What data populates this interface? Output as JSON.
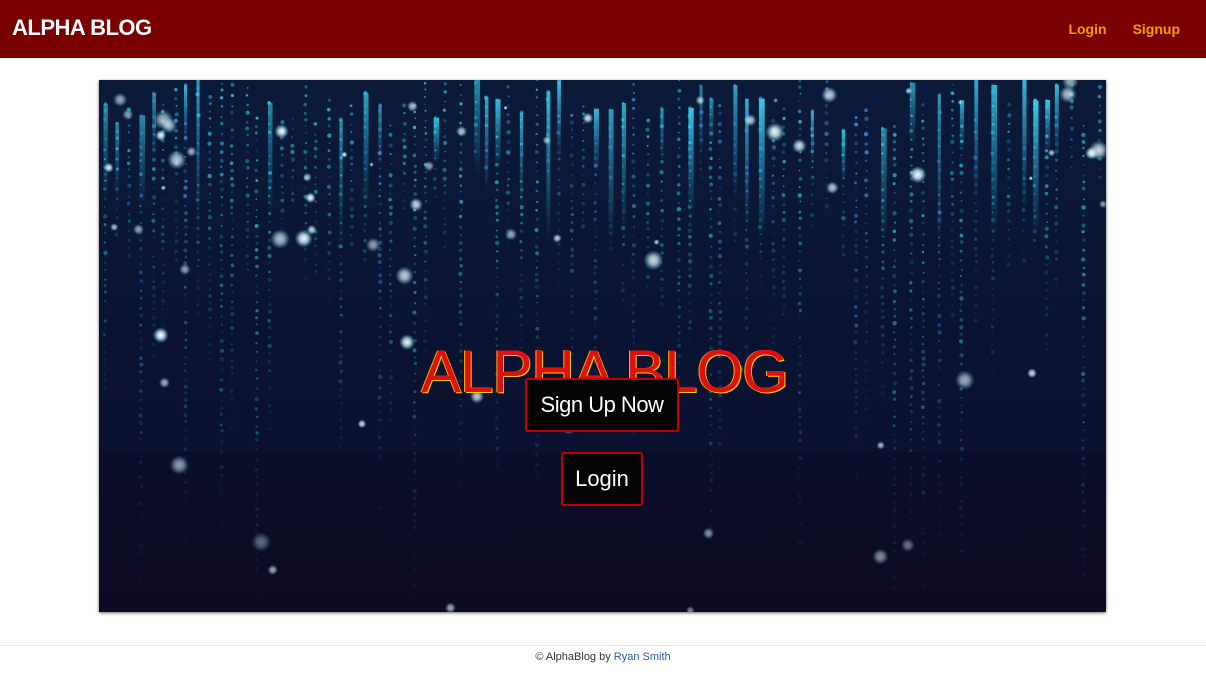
{
  "navbar": {
    "brand": "ALPHA BLOG",
    "links": [
      {
        "label": "Login"
      },
      {
        "label": "Signup"
      }
    ],
    "colors": {
      "background": "#7a0000",
      "link": "#f0a000",
      "brand": "#ffffff"
    }
  },
  "hero": {
    "background_image": "digital-rain-particles",
    "title": "ALPHA BLOG",
    "title_color": "#e01010",
    "buttons": {
      "signup": "Sign Up Now",
      "login": "Login"
    }
  },
  "footer": {
    "prefix": "© AlphaBlog by",
    "author": "Ryan Smith",
    "link_color": "#2a5db0"
  }
}
